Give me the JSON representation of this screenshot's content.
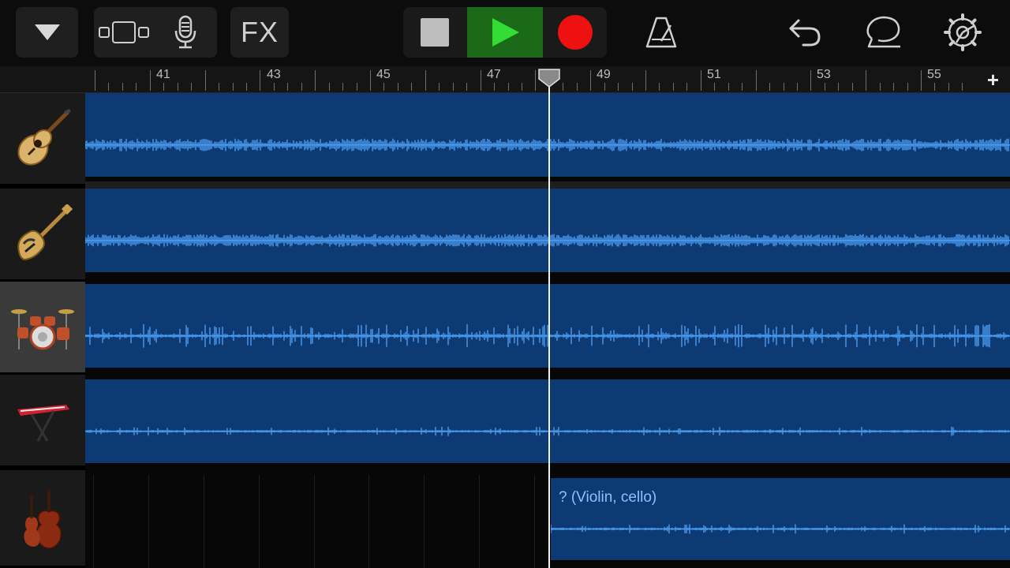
{
  "toolbar": {
    "fx_label": "FX",
    "icons": [
      "dropdown-icon",
      "track-view-icon",
      "microphone-icon",
      "stop-icon",
      "play-icon",
      "record-icon",
      "metronome-icon",
      "undo-icon",
      "loop-icon",
      "settings-icon"
    ],
    "colors": {
      "play_bg": "#1a6a1a",
      "play": "#33dd33",
      "record": "#ee1111",
      "stop": "#bdbdbd"
    }
  },
  "ruler": {
    "bars": [
      "41",
      "43",
      "45",
      "47",
      "49",
      "51",
      "53",
      "55"
    ],
    "add_label": "+"
  },
  "tracks": [
    {
      "instrument": "acoustic-guitar-icon",
      "region_label": ""
    },
    {
      "instrument": "bass-guitar-icon",
      "region_label": ""
    },
    {
      "instrument": "drum-kit-icon",
      "region_label": "",
      "selected": true
    },
    {
      "instrument": "keyboard-icon",
      "region_label": ""
    },
    {
      "instrument": "strings-icon",
      "region_label": "? (Violin, cello)"
    }
  ],
  "colors": {
    "region": "#0e3a73",
    "waveform": "#4a9cf0"
  }
}
